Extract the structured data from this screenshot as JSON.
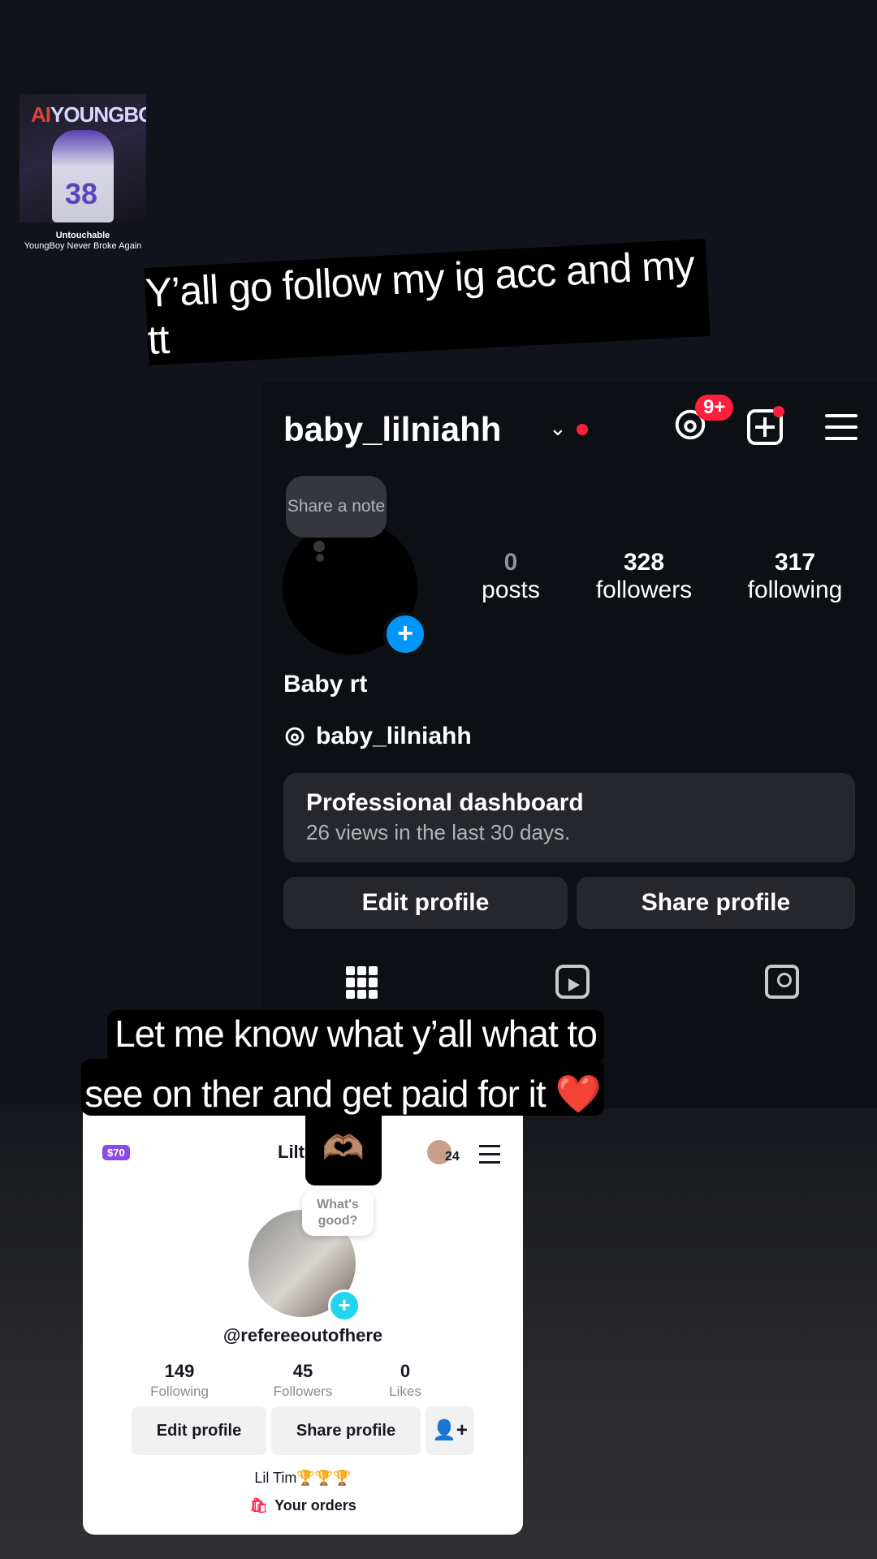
{
  "music_sticker": {
    "album_title_ai": "AI",
    "album_title_rest": "YOUNGBOY",
    "album_number": "38",
    "title": "Untouchable",
    "artist": "YoungBoy Never Broke Again"
  },
  "caption_top": "Y’all go follow my ig acc and my tt",
  "instagram": {
    "username": "baby_lilniahh",
    "threads_badge": "9+",
    "note_placeholder": "Share a note",
    "stats": {
      "posts_count": "0",
      "posts_label": "posts",
      "followers_count": "328",
      "followers_label": "followers",
      "following_count": "317",
      "following_label": "following"
    },
    "display_name": "Baby rt",
    "threads_handle": "baby_lilniahh",
    "dashboard_title": "Professional dashboard",
    "dashboard_subtitle": "26 views in the last 30 days.",
    "edit_profile": "Edit profile",
    "share_profile": "Share profile"
  },
  "caption_bottom": {
    "line1": "Let me know what y’all what to",
    "line2": "see on ther  and get paid for it",
    "heart": "❤️",
    "hands": "🫶🏽"
  },
  "tiktok": {
    "coin_label": "$70",
    "name": "Lilt",
    "notif_count": "24",
    "note_text": "What's good?",
    "handle": "@refereeoutofhere",
    "following_count": "149",
    "following_label": "Following",
    "followers_count": "45",
    "followers_label": "Followers",
    "likes_count": "0",
    "likes_label": "Likes",
    "edit_profile": "Edit profile",
    "share_profile": "Share profile",
    "add_friend_icon": "👤+",
    "bio": "Lil Tim🏆🏆🏆",
    "orders": "Your orders"
  }
}
